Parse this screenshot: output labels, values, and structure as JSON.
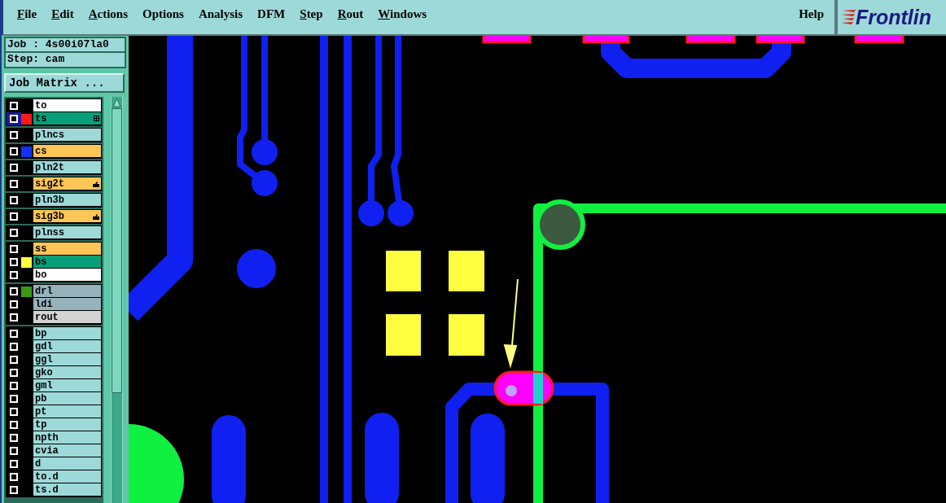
{
  "menu": [
    {
      "label": "File",
      "underlined": true
    },
    {
      "label": "Edit",
      "underlined": true
    },
    {
      "label": "Actions",
      "underlined": true
    },
    {
      "label": "Options",
      "underlined": false
    },
    {
      "label": "Analysis",
      "underlined": false
    },
    {
      "label": "DFM",
      "underlined": false
    },
    {
      "label": "Step",
      "underlined": true
    },
    {
      "label": "Rout",
      "underlined": true
    },
    {
      "label": "Windows",
      "underlined": true
    }
  ],
  "help": "Help",
  "logo": "Frontlin",
  "job": "Job : 4s00i07la0",
  "step": "Step: cam",
  "job_matrix_button": "Job Matrix ...",
  "layer_groups": [
    {
      "layers": [
        {
          "name": "to",
          "color": "#ffffff",
          "selected": false,
          "flagged": false
        },
        {
          "name": "ts",
          "color": "#079f7a",
          "swatch": {
            "color": "#ff1a1a"
          },
          "selected": true,
          "flagged": false
        }
      ]
    },
    {
      "layers": [
        {
          "name": "plncs",
          "color": "#9ed9d9",
          "selected": false,
          "flagged": false
        }
      ]
    },
    {
      "layers": [
        {
          "name": "cs",
          "color": "#ffc557",
          "swatch": {
            "color": "#1030ff"
          },
          "selected": false,
          "flagged": false
        }
      ]
    },
    {
      "layers": [
        {
          "name": "pln2t",
          "color": "#9ed9d9",
          "selected": false,
          "flagged": false
        }
      ]
    },
    {
      "layers": [
        {
          "name": "sig2t",
          "color": "#ffc557",
          "selected": false,
          "flagged": true
        }
      ]
    },
    {
      "layers": [
        {
          "name": "pln3b",
          "color": "#9ed9d9",
          "selected": false,
          "flagged": false
        }
      ]
    },
    {
      "layers": [
        {
          "name": "sig3b",
          "color": "#ffc557",
          "selected": false,
          "flagged": true
        }
      ]
    },
    {
      "layers": [
        {
          "name": "plnss",
          "color": "#9ed9d9",
          "selected": false,
          "flagged": false
        }
      ]
    },
    {
      "layers": [
        {
          "name": "ss",
          "color": "#ffc557",
          "selected": false,
          "flagged": false
        },
        {
          "name": "bs",
          "color": "#079f7a",
          "swatch": {
            "color": "#ffff40"
          },
          "selected": false,
          "flagged": false
        },
        {
          "name": "bo",
          "color": "#ffffff",
          "selected": false,
          "flagged": false
        }
      ]
    },
    {
      "layers": [
        {
          "name": "drl",
          "color": "#98b2bc",
          "swatch": {
            "color": "#3a9a10"
          },
          "selected": false,
          "flagged": false
        },
        {
          "name": "ldi",
          "color": "#98b2bc",
          "selected": false,
          "flagged": false
        },
        {
          "name": "rout",
          "color": "#d3d3d3",
          "selected": false,
          "flagged": false
        }
      ]
    },
    {
      "layers": [
        {
          "name": "bp",
          "color": "#9ed9d9",
          "selected": false,
          "flagged": false
        },
        {
          "name": "gdl",
          "color": "#9ed9d9",
          "selected": false,
          "flagged": false
        },
        {
          "name": "ggl",
          "color": "#9ed9d9",
          "selected": false,
          "flagged": false
        },
        {
          "name": "gko",
          "color": "#9ed9d9",
          "selected": false,
          "flagged": false
        },
        {
          "name": "gml",
          "color": "#9ed9d9",
          "selected": false,
          "flagged": false
        },
        {
          "name": "pb",
          "color": "#9ed9d9",
          "selected": false,
          "flagged": false
        },
        {
          "name": "pt",
          "color": "#9ed9d9",
          "selected": false,
          "flagged": false
        },
        {
          "name": "tp",
          "color": "#9ed9d9",
          "selected": false,
          "flagged": false
        },
        {
          "name": "npth",
          "color": "#9ed9d9",
          "selected": false,
          "flagged": false
        },
        {
          "name": "cvia",
          "color": "#9ed9d9",
          "selected": false,
          "flagged": false
        },
        {
          "name": "d",
          "color": "#9ed9d9",
          "selected": false,
          "flagged": false
        },
        {
          "name": "to.d",
          "color": "#9ed9d9",
          "selected": false,
          "flagged": false
        },
        {
          "name": "ts.d",
          "color": "#9ed9d9",
          "selected": false,
          "flagged": false
        }
      ]
    }
  ]
}
